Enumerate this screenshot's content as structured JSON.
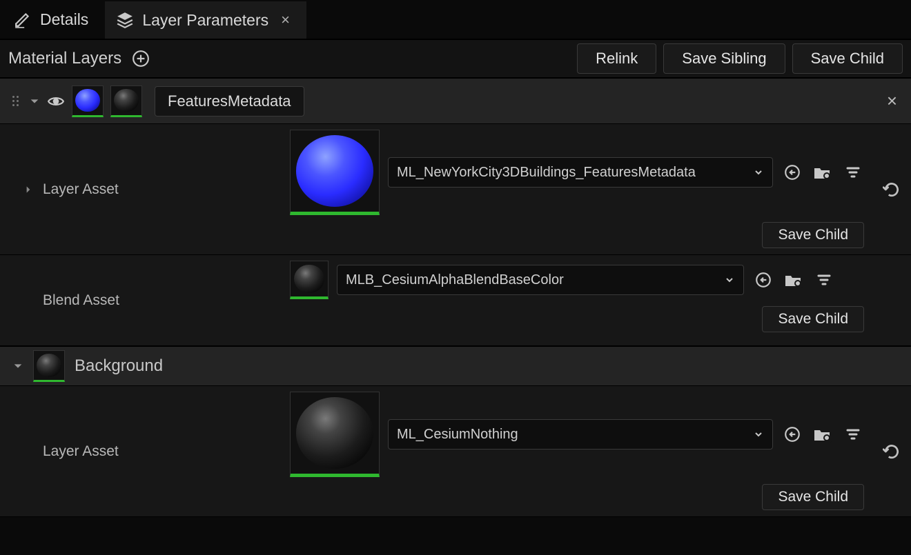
{
  "tabs": {
    "details": "Details",
    "layer_params": "Layer Parameters"
  },
  "toolbar": {
    "title": "Material Layers",
    "relink": "Relink",
    "save_sibling": "Save Sibling",
    "save_child": "Save Child"
  },
  "layers": {
    "features": {
      "name": "FeaturesMetadata",
      "layer_asset_label": "Layer Asset",
      "layer_asset_value": "ML_NewYorkCity3DBuildings_FeaturesMetadata",
      "blend_asset_label": "Blend Asset",
      "blend_asset_value": "MLB_CesiumAlphaBlendBaseColor",
      "save_child": "Save Child"
    },
    "background": {
      "name": "Background",
      "layer_asset_label": "Layer Asset",
      "layer_asset_value": "ML_CesiumNothing",
      "save_child": "Save Child"
    }
  },
  "icons": {
    "details": "details-pencil-icon",
    "layers": "layers-stack-icon",
    "add": "add-circle-icon",
    "eye": "visibility-icon",
    "close": "close-icon",
    "use_selected": "use-selected-icon",
    "browse": "browse-to-icon",
    "filter": "filter-icon",
    "revert": "revert-arrow-icon",
    "chevron_down": "chevron-down-icon",
    "expand_right": "expand-right-icon"
  }
}
